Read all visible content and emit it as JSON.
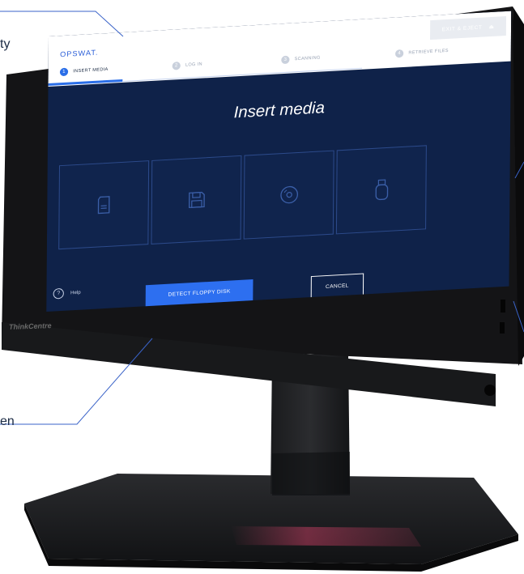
{
  "callouts": {
    "top_left_fragment": "ty",
    "bottom_left_fragment": "en"
  },
  "brand": "ThinkCentre",
  "app": {
    "logo": "OPSWAT.",
    "exit_button": "EXIT & EJECT",
    "steps": [
      {
        "num": "1",
        "label": "INSERT MEDIA",
        "active": true
      },
      {
        "num": "2",
        "label": "LOG IN",
        "active": false
      },
      {
        "num": "3",
        "label": "SCANNING",
        "active": false
      },
      {
        "num": "4",
        "label": "RETRIEVE FILES",
        "active": false
      }
    ],
    "title": "Insert media",
    "media_cards": [
      {
        "icon": "sd-card-icon"
      },
      {
        "icon": "floppy-disk-icon"
      },
      {
        "icon": "optical-disc-icon"
      },
      {
        "icon": "usb-drive-icon"
      }
    ],
    "help_label": "Help",
    "primary_button": "DETECT FLOPPY DISK",
    "cancel_button": "CANCEL"
  },
  "colors": {
    "screen_bg": "#0f2249",
    "accent": "#2d6ff0",
    "bezel": "#141416"
  }
}
